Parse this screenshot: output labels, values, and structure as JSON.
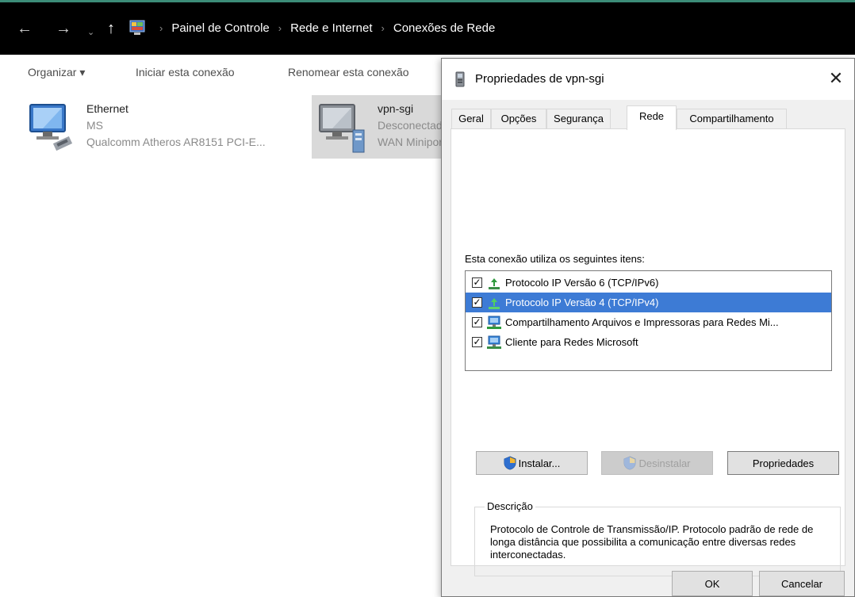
{
  "breadcrumb": {
    "items": [
      "Painel de Controle",
      "Rede e Internet",
      "Conexões de Rede"
    ]
  },
  "toolbar": {
    "organize_label": "Organizar ▾",
    "start_label": "Iniciar esta conexão",
    "rename_label": "Renomear esta conexão"
  },
  "connections": [
    {
      "name": "Ethernet",
      "status": "MS",
      "device": "Qualcomm Atheros AR8151 PCI-E...",
      "icon": "network-adapter-icon"
    },
    {
      "name": "vpn-sgi",
      "status": "Desconectado",
      "device": "WAN Miniport",
      "icon": "vpn-adapter-icon"
    }
  ],
  "dialog": {
    "title": "Propriedades de vpn-sgi",
    "tabs": [
      "Geral",
      "Opções",
      "Segurança",
      "Rede",
      "Compartilhamento"
    ],
    "active_tab": "Rede",
    "items_label": "Esta conexão utiliza os seguintes itens:",
    "items": [
      {
        "label": "Protocolo IP Versão 6 (TCP/IPv6)",
        "checked": true,
        "selected": false,
        "icon": "protocol-icon"
      },
      {
        "label": "Protocolo IP Versão 4 (TCP/IPv4)",
        "checked": true,
        "selected": true,
        "icon": "protocol-icon"
      },
      {
        "label": "Compartilhamento Arquivos e Impressoras para Redes Mi...",
        "checked": true,
        "selected": false,
        "icon": "service-icon"
      },
      {
        "label": "Cliente para Redes Microsoft",
        "checked": true,
        "selected": false,
        "icon": "client-icon"
      }
    ],
    "install_label": "Instalar...",
    "uninstall_label": "Desinstalar",
    "properties_label": "Propriedades",
    "description_legend": "Descrição",
    "description_text": "Protocolo de Controle de Transmissão/IP. Protocolo padrão de rede de longa distância que possibilita a comunicação entre diversas redes interconectadas.",
    "ok_label": "OK",
    "cancel_label": "Cancelar"
  },
  "colors": {
    "selection": "#3d7bd5",
    "accent": "#3c8c78",
    "addressbar": "#000000"
  }
}
